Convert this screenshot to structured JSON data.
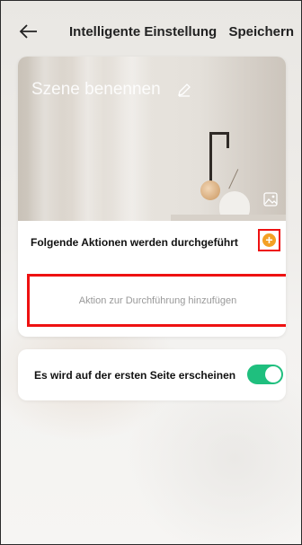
{
  "header": {
    "title": "Intelligente Einstellung",
    "save_label": "Speichern"
  },
  "scene": {
    "name_placeholder": "Szene benennen",
    "actions_title": "Folgende Aktionen werden durchgeführt",
    "add_action_label": "Aktion zur Durchführung hinzufügen"
  },
  "settings": {
    "first_page_label": "Es wird auf der ersten Seite erscheinen",
    "first_page_enabled": true
  },
  "colors": {
    "accent_green": "#1fbf7e",
    "add_orange": "#f3a024",
    "highlight_red": "#ee1111"
  },
  "icons": [
    "back-arrow-icon",
    "pencil-icon",
    "image-icon",
    "plus-circle-icon"
  ]
}
